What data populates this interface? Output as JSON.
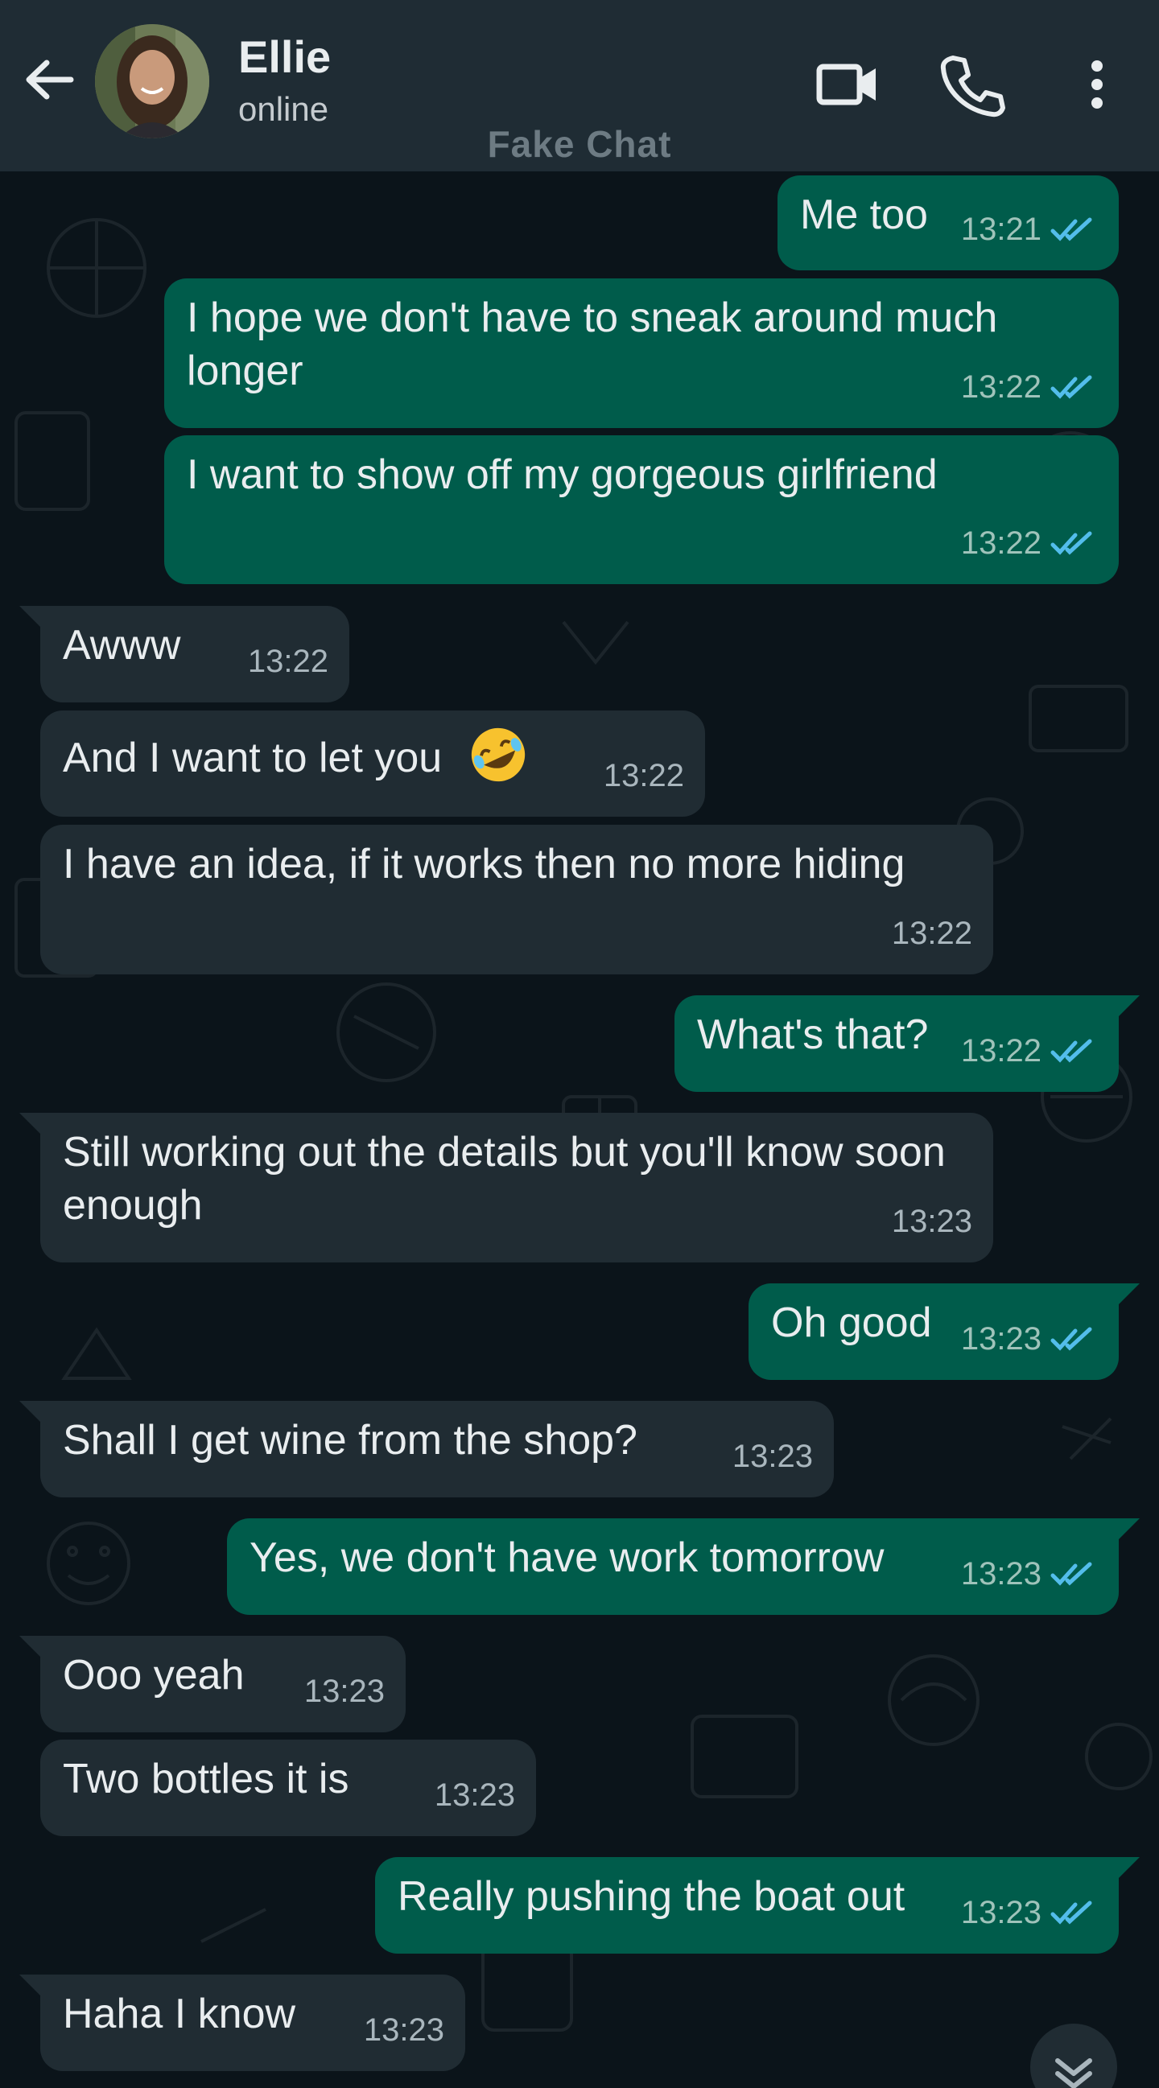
{
  "header": {
    "contact_name": "Ellie",
    "status": "online",
    "watermark": "Fake Chat",
    "icons": [
      "back-arrow-icon",
      "video-call-icon",
      "phone-icon",
      "more-vert-icon"
    ]
  },
  "colors": {
    "header_bg": "#1f2c34",
    "chat_bg": "#0b141a",
    "outgoing_bubble": "#005c4b",
    "incoming_bubble": "#202c33",
    "read_ticks": "#53bdeb"
  },
  "messages": [
    {
      "text": "Me too",
      "time": "13:21",
      "dir": "out"
    },
    {
      "text": "I hope we don't have to sneak around much longer",
      "time": "13:22",
      "dir": "out"
    },
    {
      "text": "I want to show off my gorgeous girlfriend",
      "time": "13:22",
      "dir": "out"
    },
    {
      "text": "Awww",
      "time": "13:22",
      "dir": "in"
    },
    {
      "text": "And I want to let you",
      "emoji": "rolling-on-floor-laughing-emoji",
      "time": "13:22",
      "dir": "in"
    },
    {
      "text": "I have an idea, if it works then no more hiding",
      "time": "13:22",
      "dir": "in"
    },
    {
      "text": "What's that?",
      "time": "13:22",
      "dir": "out"
    },
    {
      "text": "Still working out the details but you'll know soon enough",
      "time": "13:23",
      "dir": "in"
    },
    {
      "text": "Oh good",
      "time": "13:23",
      "dir": "out"
    },
    {
      "text": "Shall I get wine from the shop?",
      "time": "13:23",
      "dir": "in"
    },
    {
      "text": "Yes, we don't have work tomorrow",
      "time": "13:23",
      "dir": "out"
    },
    {
      "text": "Ooo yeah",
      "time": "13:23",
      "dir": "in"
    },
    {
      "text": "Two bottles it is",
      "time": "13:23",
      "dir": "in"
    },
    {
      "text": "Really pushing the boat out",
      "time": "13:23",
      "dir": "out"
    },
    {
      "text": "Haha I know",
      "time": "13:23",
      "dir": "in"
    }
  ]
}
